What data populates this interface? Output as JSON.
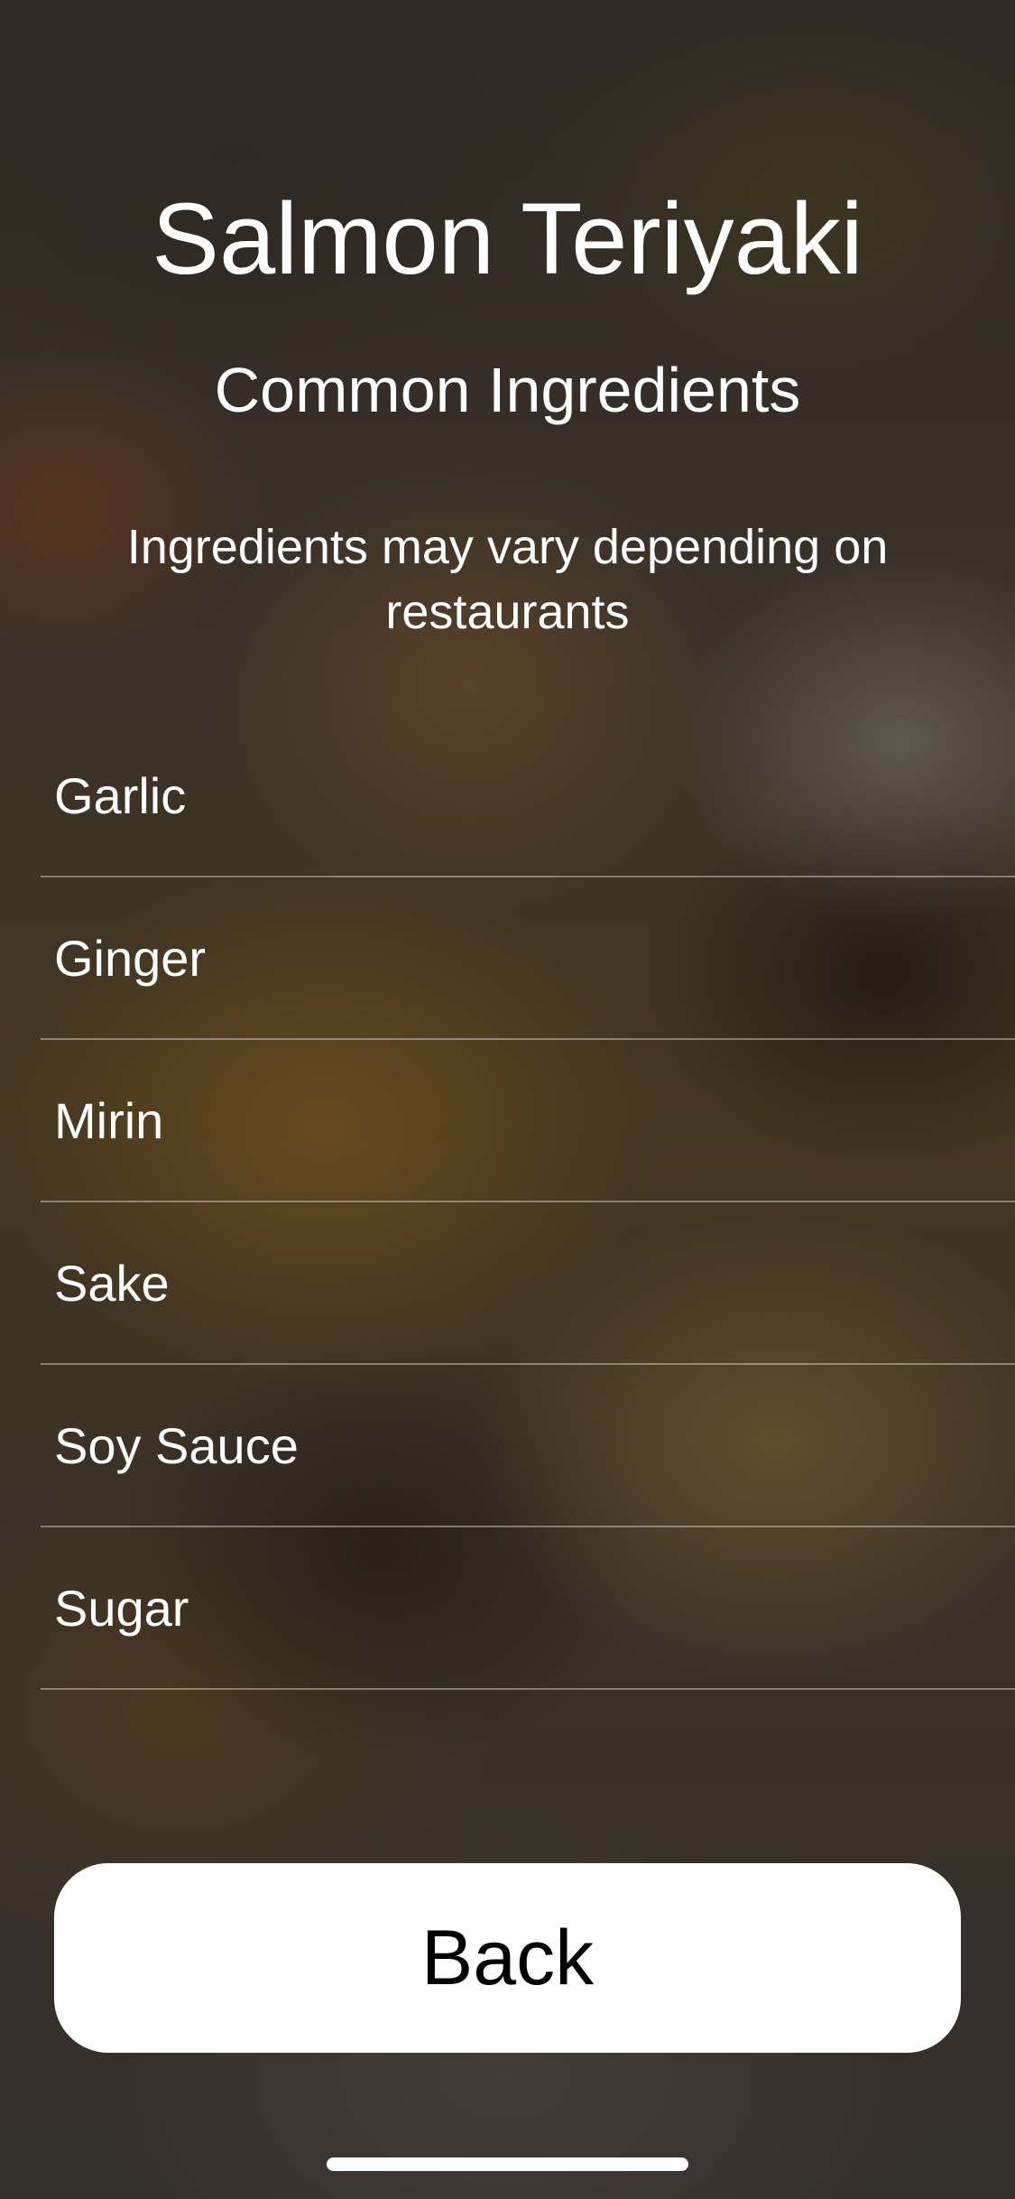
{
  "header": {
    "title": "Salmon Teriyaki",
    "subtitle": "Common Ingredients",
    "note": "Ingredients may vary depending on restaurants"
  },
  "ingredients": [
    "Garlic",
    "Ginger",
    "Mirin",
    "Sake",
    "Soy Sauce",
    "Sugar"
  ],
  "actions": {
    "back_label": "Back"
  },
  "colors": {
    "button_background": "#ffffff",
    "button_text": "#000000",
    "text": "#ffffff"
  }
}
